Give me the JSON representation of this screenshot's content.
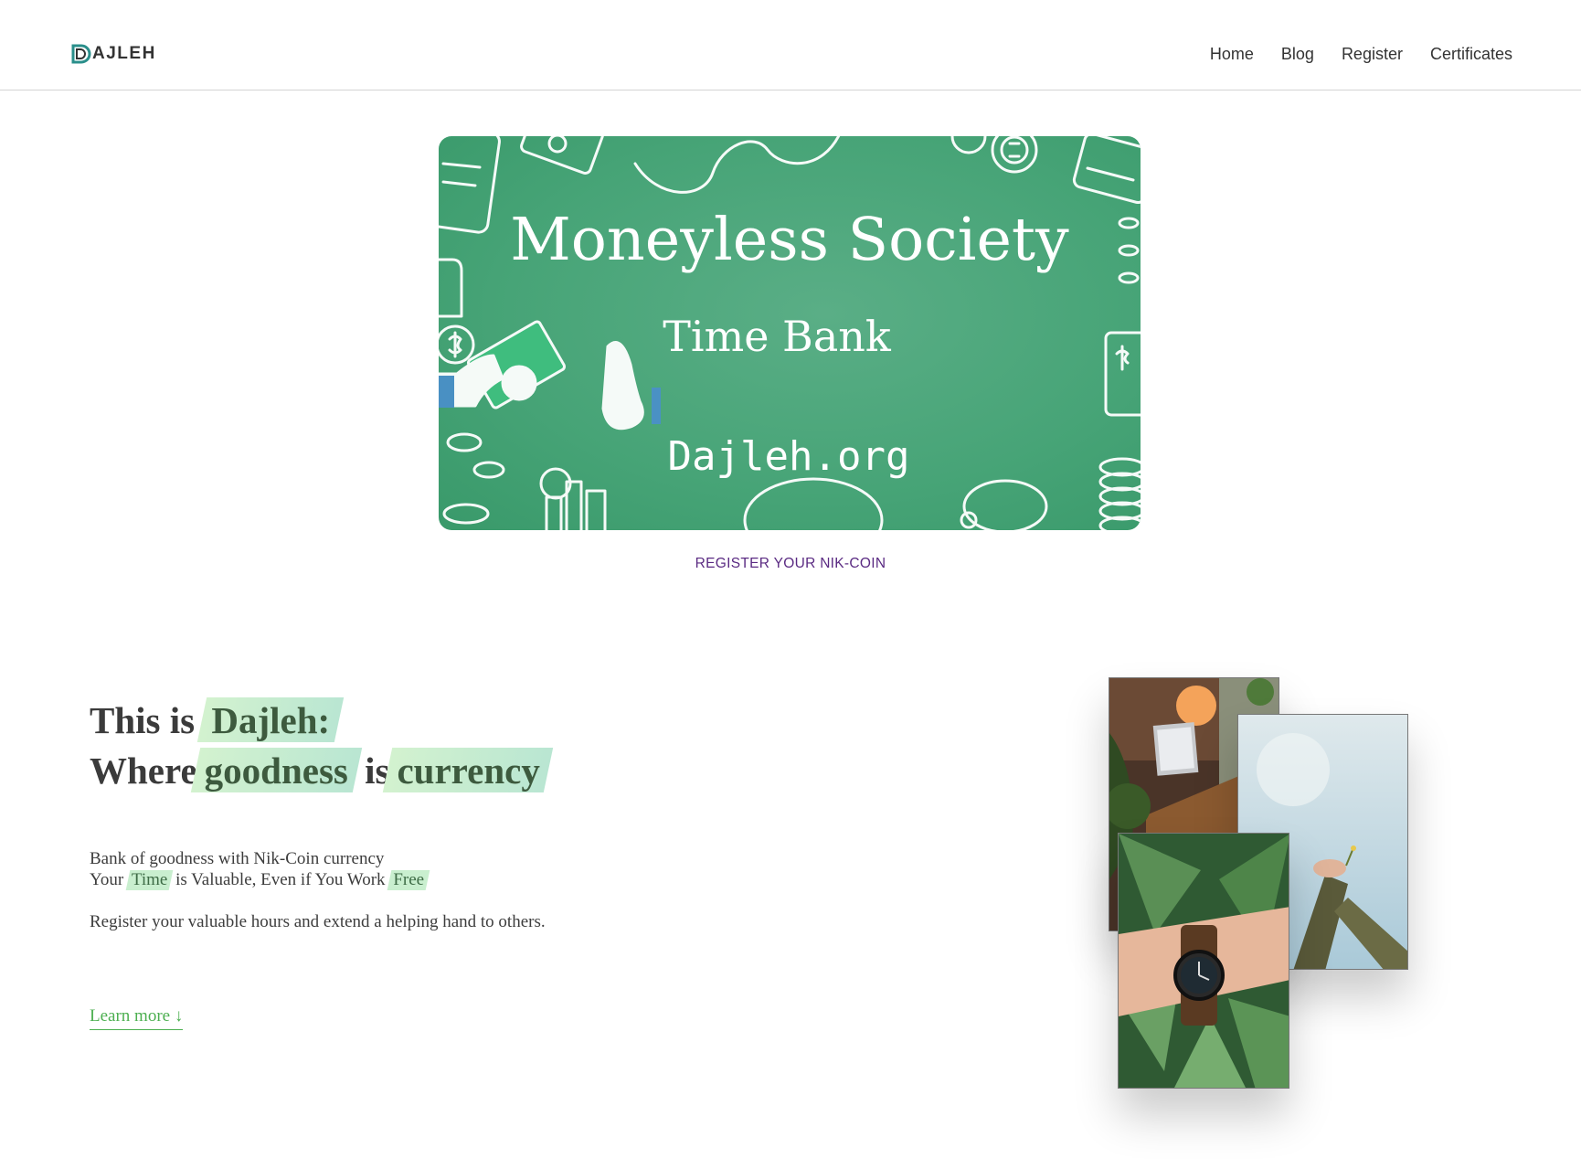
{
  "header": {
    "logo_letter": "D",
    "logo_text": "AJLEH",
    "nav": [
      "Home",
      "Blog",
      "Register",
      "Certificates"
    ]
  },
  "banner": {
    "title": "Moneyless Society",
    "subtitle": "Time Bank",
    "site": "Dajleh.org",
    "bg_color": "#4aa67b"
  },
  "register_link": "REGISTER YOUR NIK-COIN",
  "hero": {
    "line1_prefix": "This is",
    "line1_highlight": "Dajleh:",
    "line2_word1": "Where",
    "line2_highlight1": "goodness",
    "line2_word2": "is",
    "line2_highlight2": "currency",
    "desc_line1": "Bank of goodness with Nik-Coin currency",
    "desc_line2_a": "Your",
    "desc_line2_hl1": "Time",
    "desc_line2_b": "is Valuable, Even if You Work",
    "desc_line2_hl2": "Free",
    "desc_para": "Register your valuable hours and extend a helping hand to others.",
    "learn_more": "Learn more ↓"
  },
  "accent_color": "#4caf50"
}
